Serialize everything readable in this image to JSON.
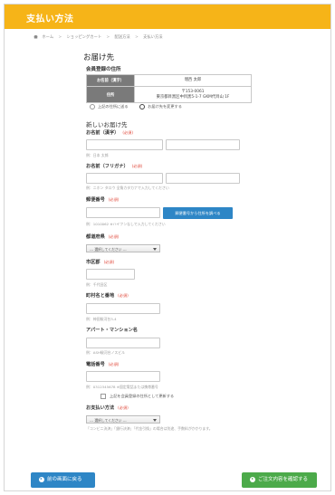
{
  "header": {
    "title": "支払い方法"
  },
  "breadcrumb": [
    "ホーム",
    "ショッピングカート",
    "配送方法",
    "支払い方法"
  ],
  "section_title": "お届け先",
  "registered": {
    "title": "会員登録の住所",
    "name_label": "お名前（漢字）",
    "name_value": "増西 太郎",
    "addr_label": "住所",
    "addr_line1": "〒153-0061",
    "addr_line2": "東京都目黒区中目黒5-1-7 GKM代目山 1F"
  },
  "radio_same": "上記の住所に送る",
  "radio_change": "お届け先を変更する",
  "new_title": "新しいお届け先",
  "required": "(必須)",
  "fields": {
    "name_kanji": {
      "label": "お名前（漢字）",
      "hint": "例：日本 太郎"
    },
    "name_kana": {
      "label": "お名前（フリガナ）",
      "hint": "例：ニホン タロウ  全角カタカナで入力してください"
    },
    "zip": {
      "label": "郵便番号",
      "hint": "例：1010062  ※ハイフンなしで入力してください",
      "button": "郵便番号から住所を調べる"
    },
    "pref": {
      "label": "都道府県",
      "select": "--- 選択してください ---"
    },
    "city": {
      "label": "市区郡",
      "hint": "例：千代田区"
    },
    "town": {
      "label": "町村名と番地",
      "hint": "例：神田駿河台3-4"
    },
    "building": {
      "label": "アパート・マンション名",
      "hint": "例：ASH駿河台ノスビル"
    },
    "phone": {
      "label": "電話番号",
      "hint": "例：0312345678  ※固定電話または携帯番号"
    }
  },
  "save_default": "上記を会員登録の住所として更新する",
  "payment": {
    "label": "お支払い方法",
    "select": "--- 選択してください ---",
    "hint": "「コンビニ決済」「銀行決済」「代金引換」の場合は別途、手数料がかかります。"
  },
  "buttons": {
    "back": "前の画面に戻る",
    "next": "ご注文内容を確認する"
  }
}
